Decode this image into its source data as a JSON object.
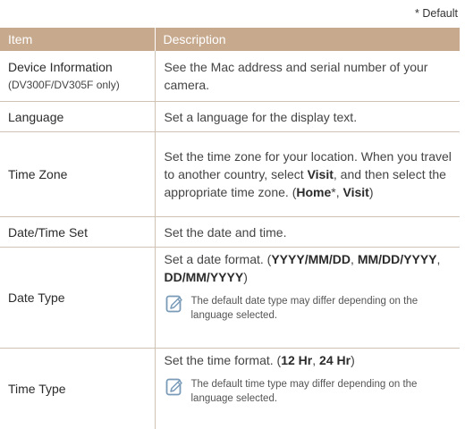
{
  "default_note": "* Default",
  "header": {
    "item": "Item",
    "description": "Description"
  },
  "rows": [
    {
      "item": "Device Information",
      "item_sub": "(DV300F/DV305F only)",
      "desc": "See the Mac address and serial number of your camera."
    },
    {
      "item": "Language",
      "desc": "Set a language for the display text."
    },
    {
      "item": "Time Zone",
      "desc_a": "Set the time zone for your location. When you travel to another country, select ",
      "desc_b": "Visit",
      "desc_c": ", and then select the appropriate time zone. (",
      "desc_d": "Home",
      "desc_e": "*, ",
      "desc_f": "Visit",
      "desc_g": ")"
    },
    {
      "item": "Date/Time Set",
      "desc": "Set the date and time."
    },
    {
      "item": "Date Type",
      "desc_a": "Set a date format. (",
      "desc_b": "YYYY/MM/DD",
      "desc_c": ", ",
      "desc_d": "MM/DD/YYYY",
      "desc_e": ", ",
      "desc_f": "DD/MM/YYYY",
      "desc_g": ")",
      "note": "The default date type may differ depending on the language selected."
    },
    {
      "item": "Time Type",
      "desc_a": "Set the time format. (",
      "desc_b": "12 Hr",
      "desc_c": ", ",
      "desc_d": "24 Hr",
      "desc_e": ")",
      "note": "The default time type may differ depending on the language selected."
    }
  ],
  "colors": {
    "header_bg": "#c7a98e",
    "rule": "#cfc3b6",
    "note_icon": "#7a9bb8"
  },
  "icons": {
    "note": "note-pencil-icon"
  }
}
